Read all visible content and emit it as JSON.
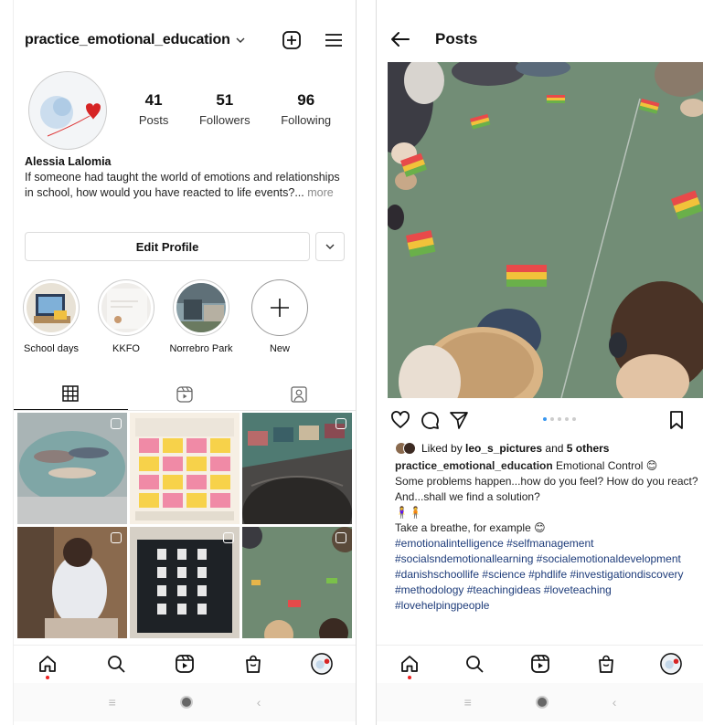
{
  "profile": {
    "username": "practice_emotional_education",
    "stats": [
      {
        "num": "41",
        "label": "Posts"
      },
      {
        "num": "51",
        "label": "Followers"
      },
      {
        "num": "96",
        "label": "Following"
      }
    ],
    "name": "Alessia Lalomia",
    "bio": "If someone had taught the world of emotions and relationships in school, how would you have reacted to life events?...",
    "more": " more",
    "edit_profile": "Edit Profile",
    "highlights": [
      {
        "label": "School days"
      },
      {
        "label": "KKFO"
      },
      {
        "label": "Norrebro Park"
      },
      {
        "label": "New"
      }
    ]
  },
  "post_view": {
    "title": "Posts",
    "carousel_dots": 5,
    "carousel_active": 1,
    "liked_by_prefix": "Liked by ",
    "liked_by_user": "leo_s_pictures",
    "liked_by_mid": " and ",
    "liked_by_others": "5 others",
    "caption_user": "practice_emotional_education",
    "caption_lines": [
      " Emotional Control 😊",
      "Some problems happen...how do you feel? How do you react?",
      "And...shall we find a solution?",
      "🧍‍♀️🧍",
      "Take a breathe, for example 😊"
    ],
    "hashtags": "#emotionalintelligence #selfmanagement #socialsndemotionallearning #socialemotionaldevelopment #danishschoollife #science #phdlife #investigationdiscovery #methodology #teachingideas #loveteaching #lovehelpingpeople"
  },
  "icons": {
    "add_post": "plus-square-icon",
    "menu": "hamburger-icon",
    "grid_tab": "grid-icon",
    "reels_tab": "reels-icon",
    "tagged_tab": "tagged-icon",
    "home": "home-icon",
    "search": "search-icon",
    "reels": "reels-icon",
    "shop": "shop-icon",
    "profile": "avatar",
    "heart": "heart-icon",
    "comment": "comment-icon",
    "share": "share-icon",
    "save": "bookmark-icon",
    "back": "back-arrow-icon"
  },
  "colors": {
    "hashtag": "#1e3c7a",
    "carousel_active": "#3897f0",
    "notification_dot": "#e22222"
  }
}
